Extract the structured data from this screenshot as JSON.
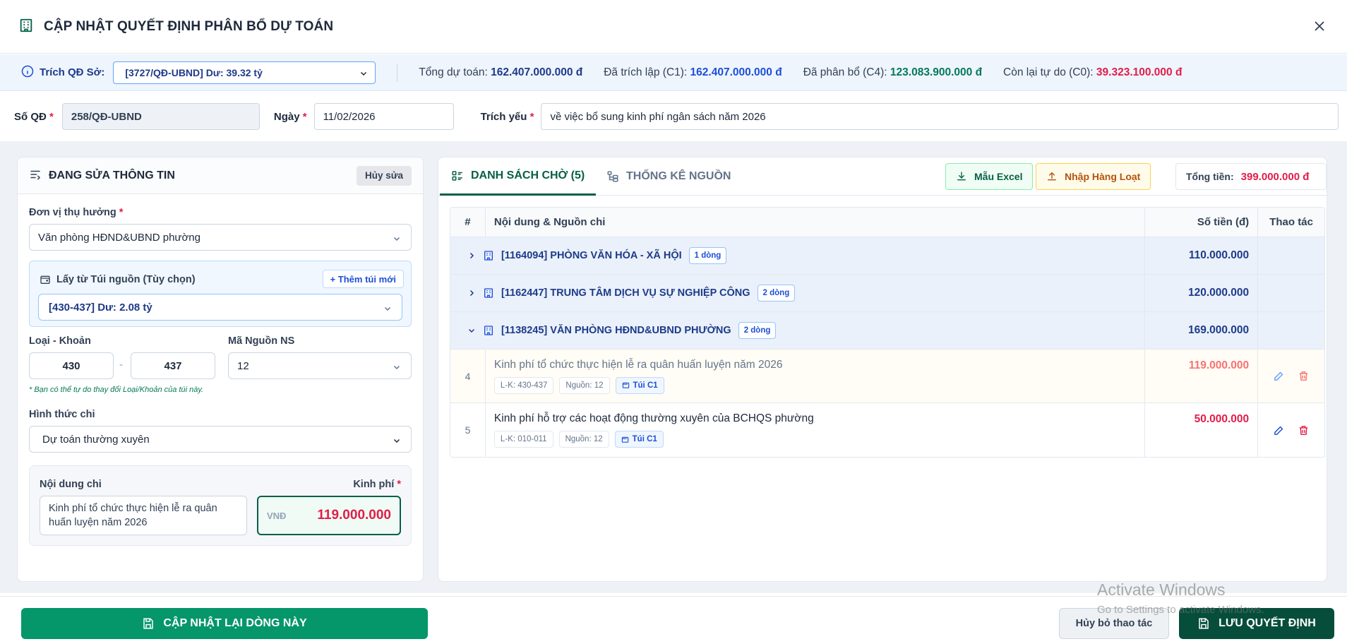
{
  "header": {
    "title": "CẬP NHẬT QUYẾT ĐỊNH PHÂN BỔ DỰ TOÁN"
  },
  "source": {
    "label": "Trích QĐ Sở:",
    "selected": "[3727/QĐ-UBND] Dư: 39.32 tỷ",
    "stats": [
      {
        "label": "Tổng dự toán:",
        "value": "162.407.000.000 đ",
        "color": "#1e3a8a"
      },
      {
        "label": "Đã trích lập (C1):",
        "value": "162.407.000.000 đ",
        "color": "#1d4ed8"
      },
      {
        "label": "Đã phân bổ (C4):",
        "value": "123.083.900.000 đ",
        "color": "#047857"
      },
      {
        "label": "Còn lại tự do (C0):",
        "value": "39.323.100.000 đ",
        "color": "#e11d48"
      }
    ]
  },
  "form": {
    "so_qd_label": "Số QĐ",
    "so_qd_value": "258/QĐ-UBND",
    "ngay_label": "Ngày",
    "ngay_value": "11/02/2026",
    "trich_yeu_label": "Trích yếu",
    "trich_yeu_value": "về việc bổ sung kinh phí ngân sách năm 2026"
  },
  "left": {
    "title": "ĐANG SỬA THÔNG TIN",
    "cancel_label": "Hủy sửa",
    "don_vi_label": "Đơn vị thụ hưởng",
    "don_vi_value": "Văn phòng HĐND&UBND phường",
    "bag_label": "Lấy từ Túi nguồn (Tùy chọn)",
    "bag_add": "+ Thêm túi mới",
    "bag_value": "[430-437] Dư: 2.08 tỷ",
    "loai_khoan_label": "Loại - Khoản",
    "loai_value": "430",
    "dash": "-",
    "khoan_value": "437",
    "ma_nguon_label": "Mã Nguồn NS",
    "ma_nguon_value": "12",
    "hint": "* Bạn có thể tự do thay đổi Loại/Khoản của túi này.",
    "hinh_thuc_label": "Hình thức chi",
    "hinh_thuc_value": "Dự toán thường xuyên",
    "noi_dung_label": "Nội dung chi",
    "kinh_phi_label": "Kinh phí",
    "noi_dung_value": "Kinh phí tổ chức thực hiện lễ ra quân huấn luyện năm 2026",
    "currency": "VNĐ",
    "amount": "119.000.000"
  },
  "right": {
    "tab_pending": "DANH SÁCH CHỜ (5)",
    "tab_stats": "THỐNG KÊ NGUỒN",
    "excel_label": "Mẫu Excel",
    "import_label": "Nhập Hàng Loạt",
    "total_label": "Tổng tiền:",
    "total_value": "399.000.000 đ",
    "columns": [
      "#",
      "Nội dung & Nguồn chi",
      "Số tiền (đ)",
      "Thao tác"
    ],
    "groups": [
      {
        "name": "[1164094] PHÒNG VĂN HÓA - XÃ HỘI",
        "count": "1 dòng",
        "amount": "110.000.000",
        "expanded": false
      },
      {
        "name": "[1162447] TRUNG TÂM DỊCH VỤ SỰ NGHIỆP CÔNG",
        "count": "2 dòng",
        "amount": "120.000.000",
        "expanded": false
      },
      {
        "name": "[1138245] VĂN PHÒNG HĐND&UBND PHƯỜNG",
        "count": "2 dòng",
        "amount": "169.000.000",
        "expanded": true
      }
    ],
    "rows": [
      {
        "idx": "4",
        "title": "Kinh phí tổ chức thực hiện lễ ra quân huấn luyện năm 2026",
        "lk": "L-K: 430-437",
        "nguon": "Nguồn: 12",
        "tui": "Túi C1",
        "amount": "119.000.000"
      },
      {
        "idx": "5",
        "title": "Kinh phí hỗ trợ các hoạt động thường xuyên của BCHQS phường",
        "lk": "L-K: 010-011",
        "nguon": "Nguồn: 12",
        "tui": "Túi C1",
        "amount": "50.000.000"
      }
    ]
  },
  "footer": {
    "update_label": "CẬP NHẬT LẠI DÒNG NÀY",
    "cancel_label": "Hủy bỏ thao tác",
    "save_label": "LƯU QUYẾT ĐỊNH"
  },
  "watermark": {
    "line1": "Activate Windows",
    "line2": "Go to Settings to activate Windows."
  }
}
